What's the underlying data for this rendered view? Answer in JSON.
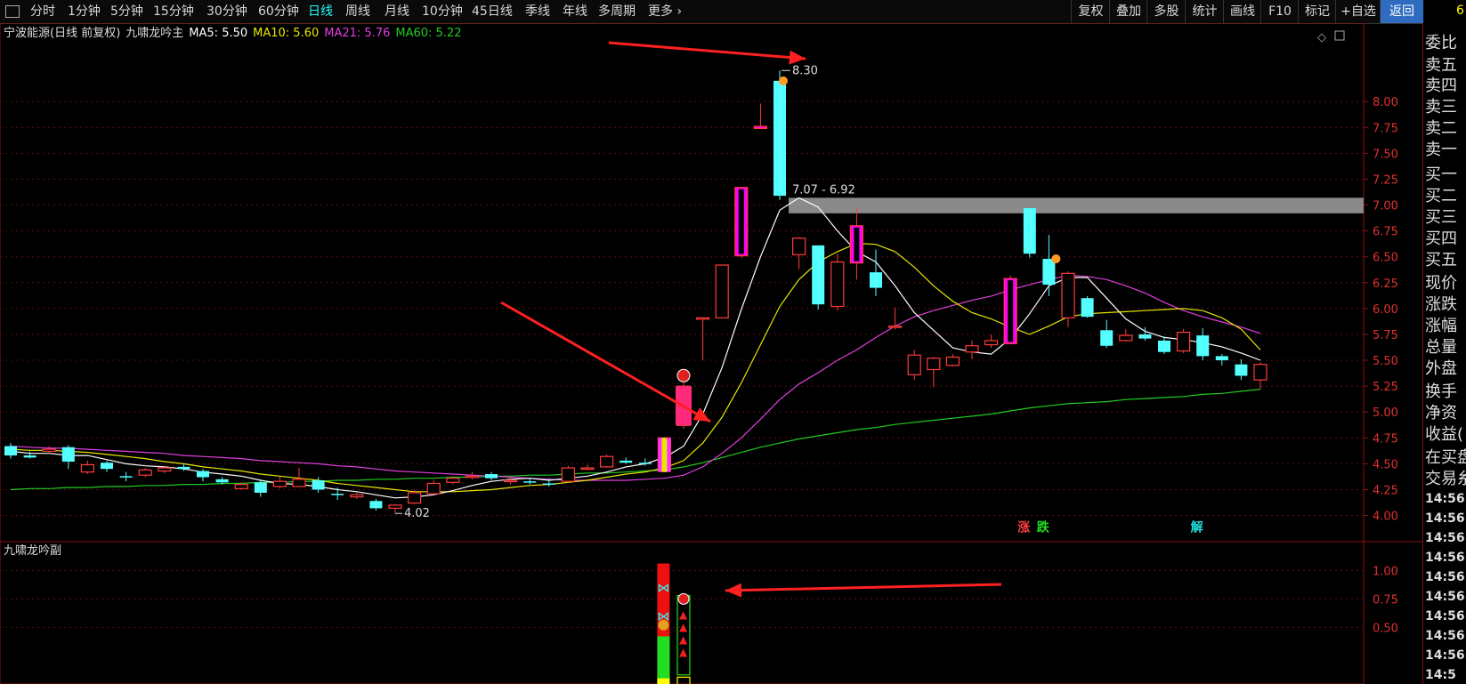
{
  "toolbar": {
    "left_tabs": [
      "分时",
      "1分钟",
      "5分钟",
      "15分钟",
      "30分钟",
      "60分钟",
      "日线",
      "周线",
      "月线",
      "10分钟",
      "45日线",
      "季线",
      "年线",
      "多周期",
      "更多"
    ],
    "active_tab": "日线",
    "right_buttons": [
      "复权",
      "叠加",
      "多股",
      "统计",
      "画线",
      "F10",
      "标记",
      "+自选",
      "返回"
    ],
    "active_right": "返回",
    "corner_value": "6"
  },
  "legend": {
    "stock": "宁波能源(日线 前复权)",
    "indicator": "九啸龙吟主",
    "ma5": "MA5: 5.50",
    "ma10": "MA10: 5.60",
    "ma21": "MA21: 5.76",
    "ma60": "MA60: 5.22"
  },
  "sub_indicator": "九啸龙吟副",
  "right_panel": {
    "labels": [
      "委比",
      "卖五",
      "卖四",
      "卖三",
      "卖二",
      "卖一",
      "买一",
      "买二",
      "买三",
      "买四",
      "买五",
      "现价",
      "涨跌",
      "涨幅",
      "总量",
      "外盘",
      "换手",
      "净资",
      "收益(",
      "在买盘",
      "交易糸"
    ],
    "times": [
      "14:56",
      "14:56",
      "14:56",
      "14:56",
      "14:56",
      "14:56",
      "14:56",
      "14:56",
      "14:56",
      "14:5"
    ]
  },
  "colors": {
    "up": "#ff3b3b",
    "down": "#54ffff",
    "ma5": "#ffffff",
    "ma10": "#e6e600",
    "ma21": "#e040e0",
    "ma60": "#22cc22",
    "zone": "#8a8a8a",
    "magenta": "#ff00ff",
    "arrow": "#ff2020"
  },
  "chart_data": {
    "type": "candlestick",
    "ylim": [
      3.85,
      8.5
    ],
    "yticks": [
      "8.00",
      "7.75",
      "7.50",
      "7.25",
      "7.00",
      "6.75",
      "6.50",
      "6.25",
      "6.00",
      "5.75",
      "5.50",
      "5.25",
      "5.00",
      "4.75",
      "4.50",
      "4.25",
      "4.00"
    ],
    "annotations": {
      "high": "8.30",
      "low": "4.02",
      "zone": "7.07 - 6.92"
    },
    "signals": [
      "涨",
      "跌",
      "解"
    ],
    "candles": [
      [
        4.67,
        4.7,
        4.55,
        4.58
      ],
      [
        4.58,
        4.62,
        4.55,
        4.56
      ],
      [
        4.62,
        4.67,
        4.6,
        4.64
      ],
      [
        4.66,
        4.68,
        4.45,
        4.52
      ],
      [
        4.42,
        4.53,
        4.4,
        4.49
      ],
      [
        4.51,
        4.53,
        4.42,
        4.45
      ],
      [
        4.38,
        4.42,
        4.33,
        4.37
      ],
      [
        4.39,
        4.46,
        4.37,
        4.44
      ],
      [
        4.43,
        4.48,
        4.41,
        4.46
      ],
      [
        4.47,
        4.5,
        4.43,
        4.45
      ],
      [
        4.43,
        4.45,
        4.33,
        4.37
      ],
      [
        4.35,
        4.37,
        4.3,
        4.32
      ],
      [
        4.26,
        4.32,
        4.25,
        4.3
      ],
      [
        4.32,
        4.35,
        4.18,
        4.22
      ],
      [
        4.28,
        4.38,
        4.26,
        4.33
      ],
      [
        4.28,
        4.46,
        4.28,
        4.35
      ],
      [
        4.34,
        4.37,
        4.22,
        4.25
      ],
      [
        4.21,
        4.27,
        4.15,
        4.2
      ],
      [
        4.18,
        4.22,
        4.16,
        4.2
      ],
      [
        4.14,
        4.16,
        4.05,
        4.07
      ],
      [
        4.07,
        4.11,
        4.02,
        4.1
      ],
      [
        4.12,
        4.25,
        4.11,
        4.22
      ],
      [
        4.21,
        4.34,
        4.2,
        4.31
      ],
      [
        4.32,
        4.38,
        4.3,
        4.36
      ],
      [
        4.37,
        4.42,
        4.35,
        4.38
      ],
      [
        4.4,
        4.42,
        4.34,
        4.36
      ],
      [
        4.34,
        4.37,
        4.3,
        4.34
      ],
      [
        4.33,
        4.36,
        4.3,
        4.32
      ],
      [
        4.31,
        4.36,
        4.28,
        4.3
      ],
      [
        4.33,
        4.48,
        4.32,
        4.46
      ],
      [
        4.46,
        4.49,
        4.44,
        4.46
      ],
      [
        4.47,
        4.59,
        4.46,
        4.57
      ],
      [
        4.53,
        4.56,
        4.5,
        4.51
      ],
      [
        4.51,
        4.55,
        4.48,
        4.5
      ],
      [
        4.43,
        4.76,
        4.42,
        4.75
      ],
      [
        4.87,
        5.3,
        4.84,
        5.25
      ],
      [
        5.91,
        5.91,
        5.5,
        5.91
      ],
      [
        5.91,
        6.34,
        6.31,
        6.42
      ],
      [
        6.51,
        7.17,
        6.49,
        7.17
      ],
      [
        7.74,
        7.98,
        7.74,
        7.76
      ],
      [
        8.2,
        8.3,
        7.05,
        7.09
      ],
      [
        6.52,
        6.69,
        6.38,
        6.68
      ],
      [
        6.61,
        6.61,
        5.99,
        6.04
      ],
      [
        6.02,
        6.53,
        5.98,
        6.45
      ],
      [
        6.44,
        6.98,
        6.28,
        6.8
      ],
      [
        6.35,
        6.57,
        6.12,
        6.2
      ],
      [
        5.83,
        6.01,
        5.8,
        5.83
      ],
      [
        5.36,
        5.6,
        5.31,
        5.55
      ],
      [
        5.41,
        5.53,
        5.24,
        5.52
      ],
      [
        5.45,
        5.56,
        5.44,
        5.53
      ],
      [
        5.58,
        5.69,
        5.51,
        5.64
      ],
      [
        5.65,
        5.75,
        5.62,
        5.69
      ],
      [
        5.66,
        6.32,
        5.66,
        6.29
      ],
      [
        6.97,
        6.97,
        6.49,
        6.53
      ],
      [
        6.48,
        6.71,
        6.12,
        6.23
      ],
      [
        5.91,
        6.36,
        5.82,
        6.34
      ],
      [
        6.1,
        6.12,
        5.91,
        5.92
      ],
      [
        5.79,
        5.89,
        5.62,
        5.64
      ],
      [
        5.69,
        5.8,
        5.68,
        5.74
      ],
      [
        5.75,
        5.82,
        5.69,
        5.71
      ],
      [
        5.69,
        5.73,
        5.56,
        5.58
      ],
      [
        5.59,
        5.8,
        5.57,
        5.77
      ],
      [
        5.74,
        5.81,
        5.5,
        5.54
      ],
      [
        5.54,
        5.56,
        5.45,
        5.5
      ],
      [
        5.46,
        5.51,
        5.31,
        5.35
      ],
      [
        5.31,
        5.48,
        5.22,
        5.46
      ]
    ],
    "series": {
      "ma5": [
        4.62,
        4.6,
        4.6,
        4.58,
        4.58,
        4.54,
        4.5,
        4.48,
        4.47,
        4.45,
        4.42,
        4.4,
        4.38,
        4.34,
        4.31,
        4.3,
        4.28,
        4.25,
        4.23,
        4.2,
        4.17,
        4.18,
        4.2,
        4.24,
        4.29,
        4.33,
        4.35,
        4.36,
        4.34,
        4.36,
        4.38,
        4.42,
        4.47,
        4.5,
        4.56,
        4.67,
        4.98,
        5.43,
        5.99,
        6.5,
        6.95,
        7.07,
        6.98,
        6.75,
        6.55,
        6.45,
        6.22,
        5.96,
        5.79,
        5.62,
        5.58,
        5.56,
        5.71,
        5.95,
        6.22,
        6.3,
        6.3,
        6.1,
        5.9,
        5.78,
        5.72,
        5.7,
        5.67,
        5.63,
        5.57,
        5.5
      ],
      "ma10": [
        4.64,
        4.63,
        4.63,
        4.62,
        4.61,
        4.59,
        4.57,
        4.55,
        4.52,
        4.5,
        4.47,
        4.45,
        4.43,
        4.4,
        4.38,
        4.36,
        4.34,
        4.31,
        4.29,
        4.27,
        4.25,
        4.23,
        4.23,
        4.23,
        4.24,
        4.25,
        4.27,
        4.29,
        4.3,
        4.32,
        4.34,
        4.37,
        4.4,
        4.42,
        4.46,
        4.53,
        4.7,
        4.95,
        5.28,
        5.65,
        6.02,
        6.28,
        6.45,
        6.55,
        6.63,
        6.62,
        6.55,
        6.4,
        6.22,
        6.07,
        5.96,
        5.9,
        5.82,
        5.75,
        5.83,
        5.92,
        5.95,
        5.96,
        5.97,
        5.98,
        5.99,
        6.0,
        5.98,
        5.91,
        5.8,
        5.6
      ],
      "ma21": [
        4.67,
        4.66,
        4.65,
        4.65,
        4.64,
        4.63,
        4.62,
        4.61,
        4.6,
        4.58,
        4.57,
        4.56,
        4.55,
        4.53,
        4.52,
        4.51,
        4.5,
        4.48,
        4.47,
        4.45,
        4.43,
        4.42,
        4.41,
        4.4,
        4.39,
        4.38,
        4.37,
        4.36,
        4.35,
        4.34,
        4.34,
        4.34,
        4.34,
        4.35,
        4.36,
        4.39,
        4.47,
        4.6,
        4.75,
        4.93,
        5.12,
        5.27,
        5.38,
        5.5,
        5.6,
        5.72,
        5.83,
        5.92,
        5.98,
        6.03,
        6.08,
        6.12,
        6.18,
        6.23,
        6.28,
        6.32,
        6.31,
        6.28,
        6.22,
        6.15,
        6.06,
        5.98,
        5.92,
        5.87,
        5.82,
        5.76
      ],
      "ma60": [
        4.25,
        4.26,
        4.26,
        4.27,
        4.27,
        4.28,
        4.28,
        4.29,
        4.29,
        4.3,
        4.3,
        4.31,
        4.31,
        4.32,
        4.32,
        4.33,
        4.33,
        4.34,
        4.34,
        4.35,
        4.35,
        4.36,
        4.36,
        4.37,
        4.37,
        4.38,
        4.38,
        4.39,
        4.39,
        4.4,
        4.41,
        4.41,
        4.42,
        4.43,
        4.44,
        4.47,
        4.51,
        4.56,
        4.61,
        4.66,
        4.7,
        4.74,
        4.77,
        4.8,
        4.83,
        4.85,
        4.88,
        4.9,
        4.92,
        4.94,
        4.96,
        4.98,
        5.01,
        5.04,
        5.06,
        5.08,
        5.09,
        5.1,
        5.12,
        5.13,
        5.14,
        5.15,
        5.17,
        5.18,
        5.2,
        5.22
      ]
    },
    "sub_ylim": [
      0,
      1.2
    ],
    "sub_yticks": [
      "1.00",
      "0.75",
      "0.50"
    ]
  }
}
